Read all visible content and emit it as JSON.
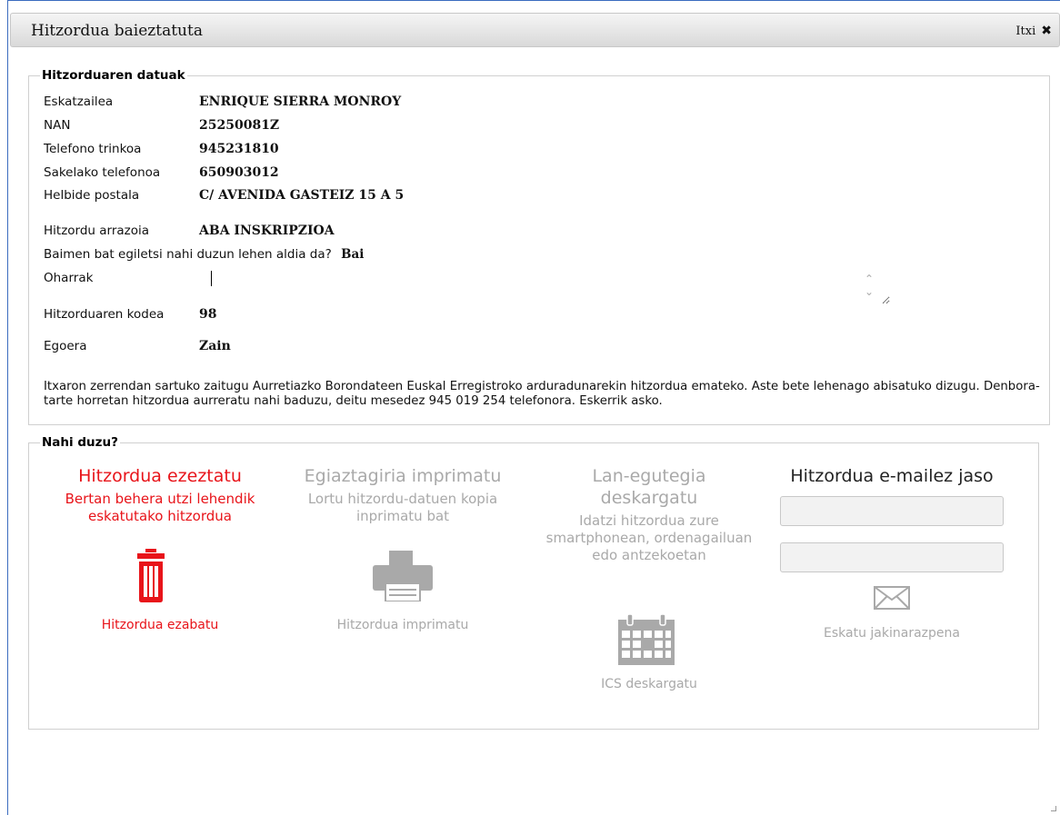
{
  "dialog": {
    "title": "Hitzordua baieztatuta",
    "close_label": "Itxi"
  },
  "appointment_data": {
    "legend": "Hitzorduaren datuak",
    "fields": [
      {
        "label": "Eskatzailea",
        "value": "ENRIQUE SIERRA MONROY"
      },
      {
        "label": "NAN",
        "value": "25250081Z"
      },
      {
        "label": "Telefono trinkoa",
        "value": "945231810"
      },
      {
        "label": "Sakelako telefonoa",
        "value": "650903012"
      },
      {
        "label": "Helbide postala",
        "value": "C/ AVENIDA GASTEIZ 15 A 5"
      }
    ],
    "reason_label": "Hitzordu arrazoia",
    "reason_value": "ABA INSKRIPZIOA",
    "first_time_question": "Baimen bat egiletsi nahi duzun lehen aldia da?",
    "first_time_answer": "Bai",
    "notes_label": "Oharrak",
    "notes_value": "",
    "code_label": "Hitzorduaren kodea",
    "code_value": "98",
    "status_label": "Egoera",
    "status_value": "Zain",
    "info_text": "Itxaron zerrendan sartuko zaitugu Aurretiazko Borondateen Euskal Erregistroko arduradunarekin hitzordua emateko. Aste bete lehenago abisatuko dizugu. Denbora-tarte horretan hitzordua aurreratu nahi baduzu, deitu mesedez 945 019 254 telefonora. Eskerrik asko."
  },
  "actions": {
    "legend": "Nahi duzu?",
    "cancel": {
      "heading": "Hitzordua ezeztatu",
      "description": "Bertan behera utzi lehendik eskatutako hitzordua",
      "link": "Hitzordua ezabatu",
      "icon": "trash-icon",
      "color": "#e8141a"
    },
    "print": {
      "heading": "Egiaztagiria imprimatu",
      "description": "Lortu hitzordu-datuen kopia inprimatu bat",
      "link": "Hitzordua imprimatu",
      "icon": "printer-icon",
      "color": "#a9a9a9"
    },
    "calendar": {
      "heading": "Lan-egutegia deskargatu",
      "description": "Idatzi hitzordua zure smartphonean, ordenagailuan edo antzekoetan",
      "link": "ICS deskargatu",
      "icon": "calendar-icon"
    },
    "email": {
      "heading": "Hitzordua e-mailez jaso",
      "email_value": "",
      "email_confirm_value": "",
      "link": "Eskatu jakinarazpena",
      "icon": "envelope-icon"
    }
  }
}
